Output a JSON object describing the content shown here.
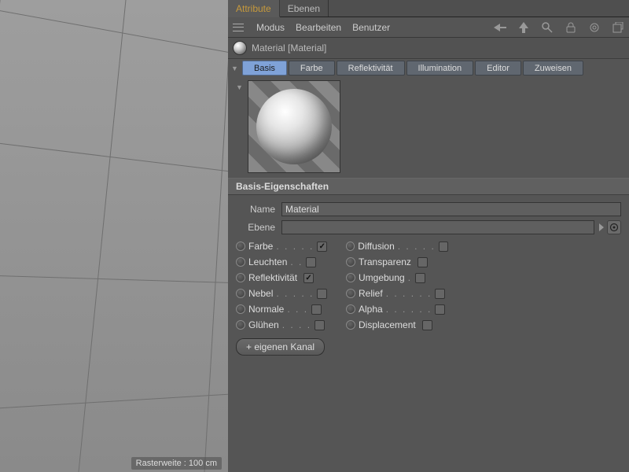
{
  "viewport": {
    "raster_label": "Rasterweite : 100 cm"
  },
  "top_tabs": [
    {
      "label": "Attribute",
      "active": true
    },
    {
      "label": "Ebenen",
      "active": false
    }
  ],
  "menubar": {
    "items": [
      "Modus",
      "Bearbeiten",
      "Benutzer"
    ]
  },
  "material_header": {
    "title": "Material [Material]"
  },
  "channel_tabs": [
    {
      "label": "Basis",
      "active": true
    },
    {
      "label": "Farbe"
    },
    {
      "label": "Reflektivität"
    },
    {
      "label": "Illumination"
    },
    {
      "label": "Editor"
    },
    {
      "label": "Zuweisen"
    }
  ],
  "section_title": "Basis-Eigenschaften",
  "fields": {
    "name_label": "Name",
    "name_value": "Material",
    "layer_label": "Ebene",
    "layer_value": ""
  },
  "channels_left": [
    {
      "label": "Farbe",
      "dots": ". . . . .",
      "checked": true
    },
    {
      "label": "Leuchten",
      "dots": ". .",
      "checked": false
    },
    {
      "label": "Reflektivität",
      "dots": "",
      "checked": true
    },
    {
      "label": "Nebel",
      "dots": ". . . . .",
      "checked": false
    },
    {
      "label": "Normale",
      "dots": ". . .",
      "checked": false
    },
    {
      "label": "Glühen",
      "dots": ". . . .",
      "checked": false
    }
  ],
  "channels_right": [
    {
      "label": "Diffusion",
      "dots": ". . . . .",
      "checked": false
    },
    {
      "label": "Transparenz",
      "dots": "",
      "checked": false
    },
    {
      "label": "Umgebung",
      "dots": ".",
      "checked": false
    },
    {
      "label": "Relief",
      "dots": ". . . . . .",
      "checked": false
    },
    {
      "label": "Alpha",
      "dots": ". . . . . .",
      "checked": false
    },
    {
      "label": "Displacement",
      "dots": "",
      "checked": false
    }
  ],
  "add_channel_label": "+ eigenen Kanal"
}
